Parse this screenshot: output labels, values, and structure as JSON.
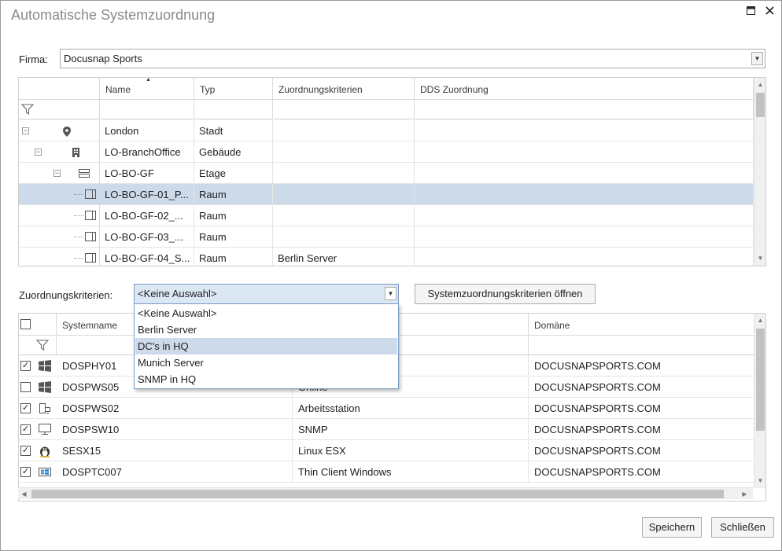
{
  "window": {
    "title": "Automatische Systemzuordnung",
    "maximize_icon": "maximize-icon",
    "close_icon": "close-icon"
  },
  "firma": {
    "label": "Firma:",
    "value": "Docusnap Sports"
  },
  "tree_grid": {
    "columns": [
      "Name",
      "Typ",
      "Zuordnungskriterien",
      "DDS Zuordnung"
    ],
    "rows": [
      {
        "name": "London",
        "typ": "Stadt",
        "kriterien": "",
        "dds": "",
        "icon": "location-pin-icon"
      },
      {
        "name": "LO-BranchOffice",
        "typ": "Gebäude",
        "kriterien": "",
        "dds": "",
        "icon": "building-icon"
      },
      {
        "name": "LO-BO-GF",
        "typ": "Etage",
        "kriterien": "",
        "dds": "",
        "icon": "floor-icon"
      },
      {
        "name": "LO-BO-GF-01_P...",
        "typ": "Raum",
        "kriterien": "",
        "dds": "",
        "icon": "room-icon"
      },
      {
        "name": "LO-BO-GF-02_...",
        "typ": "Raum",
        "kriterien": "",
        "dds": "",
        "icon": "room-icon"
      },
      {
        "name": "LO-BO-GF-03_...",
        "typ": "Raum",
        "kriterien": "",
        "dds": "",
        "icon": "room-icon"
      },
      {
        "name": "LO-BO-GF-04_S...",
        "typ": "Raum",
        "kriterien": "Berlin Server",
        "dds": "",
        "icon": "room-icon"
      }
    ],
    "selected_row": 3
  },
  "criteria": {
    "label": "Zuordnungskriterien:",
    "selected": "<Keine Auswahl>",
    "options": [
      "<Keine Auswahl>",
      "Berlin Server",
      "DC's in HQ",
      "Munich Server",
      "SNMP in HQ"
    ],
    "highlighted_option": 2,
    "open_button": "Systemzuordnungskriterien öffnen"
  },
  "systems_grid": {
    "columns": [
      "Systemname",
      "Domäne"
    ],
    "rows": [
      {
        "checked": true,
        "name": "DOSPHY01",
        "type": "",
        "domain": "DOCUSNAPSPORTS.COM",
        "icon": "windows-icon"
      },
      {
        "checked": false,
        "name": "DOSPWS05",
        "type": "Online",
        "domain": "DOCUSNAPSPORTS.COM",
        "icon": "windows-icon"
      },
      {
        "checked": true,
        "name": "DOSPWS02",
        "type": "Arbeitsstation",
        "domain": "DOCUSNAPSPORTS.COM",
        "icon": "workstation-icon"
      },
      {
        "checked": true,
        "name": "DOSPSW10",
        "type": "SNMP",
        "domain": "DOCUSNAPSPORTS.COM",
        "icon": "monitor-icon"
      },
      {
        "checked": true,
        "name": "SESX15",
        "type": "Linux ESX",
        "domain": "DOCUSNAPSPORTS.COM",
        "icon": "linux-icon"
      },
      {
        "checked": true,
        "name": "DOSPTC007",
        "type": "Thin Client Windows",
        "domain": "DOCUSNAPSPORTS.COM",
        "icon": "windows-thin-client-icon"
      }
    ]
  },
  "buttons": {
    "save": "Speichern",
    "close": "Schließen"
  },
  "colors": {
    "selection": "#cddaea",
    "border": "#cfcfcf",
    "title": "#8a8a8a"
  }
}
